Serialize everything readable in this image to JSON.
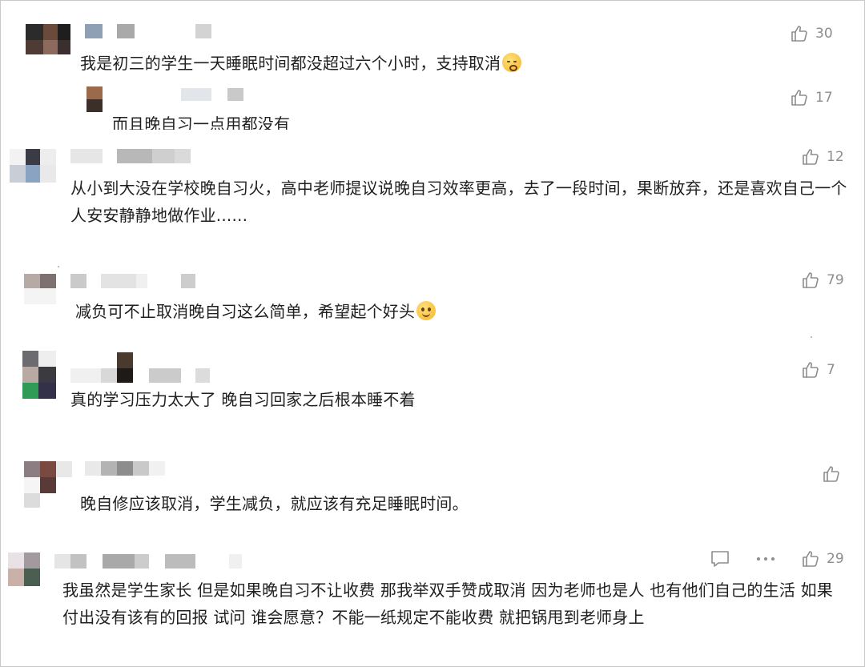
{
  "comments": [
    {
      "likes": "30",
      "text": "我是初三的学生一天睡眠时间都没超过六个小时，支持取消"
    },
    {
      "likes": "17",
      "text": "而且晚自习一点用都没有"
    },
    {
      "likes": "12",
      "text": "从小到大没在学校晚自习火，高中老师提议说晚自习效率更高，去了一段时间，果断放弃，还是喜欢自己一个人安安静静地做作业......"
    },
    {
      "likes": "79",
      "text": "减负可不止取消晚自习这么简单，希望起个好头"
    },
    {
      "likes": "7",
      "text": "真的学习压力太大了 晚自习回家之后根本睡不着"
    },
    {
      "likes": "",
      "text": "晚自修应该取消，学生减负，就应该有充足睡眠时间。"
    },
    {
      "likes": "29",
      "text": "我虽然是学生家长 但是如果晚自习不让收费 那我举双手赞成取消 因为老师也是人 也有他们自己的生活 如果付出没有该有的回报 试问 谁会愿意？不能一纸规定不能收费 就把锅甩到老师身上"
    }
  ],
  "icons": {
    "like": "thumbs-up-icon",
    "reply": "comment-icon",
    "more": "more-icon",
    "sleepy_emoji": "sleepy-face-emoji",
    "smile_emoji": "smiling-face-emoji"
  },
  "colors": {
    "text": "#1f1f1f",
    "meta": "#8d8d8d",
    "border": "#c8c8c8"
  }
}
